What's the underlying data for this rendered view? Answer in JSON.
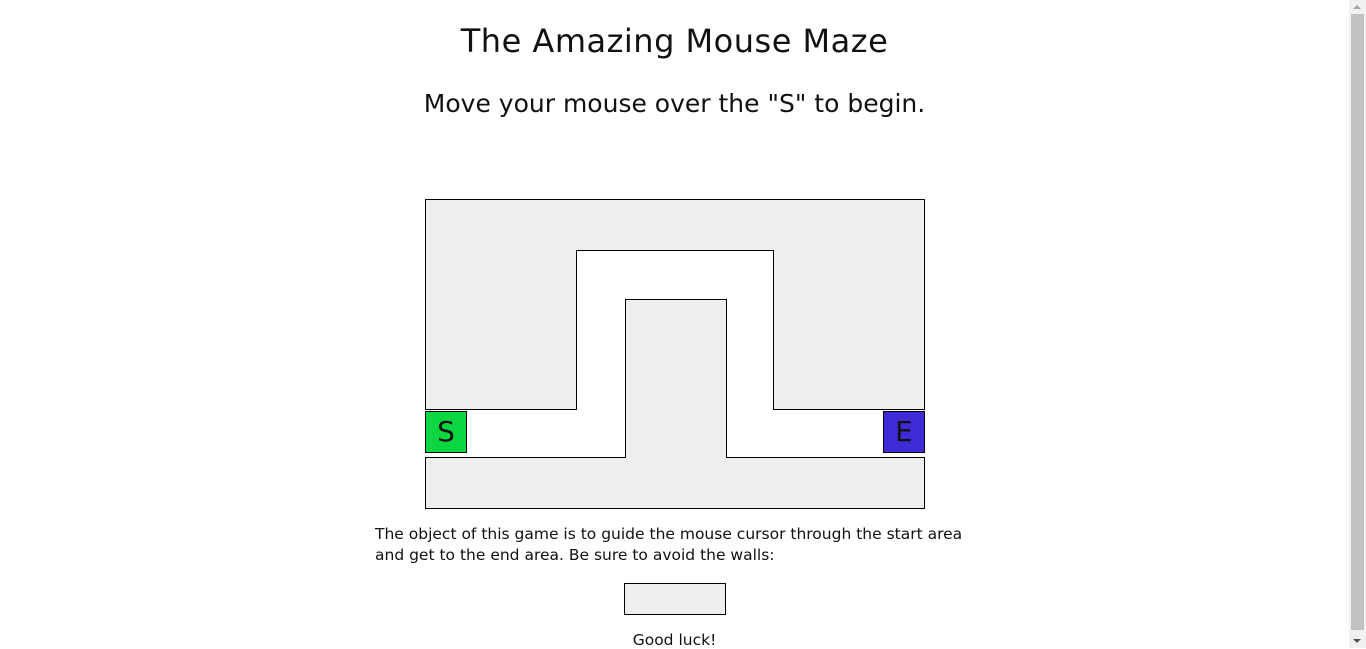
{
  "title": "The Amazing Mouse Maze",
  "status": "Move your mouse over the \"S\" to begin.",
  "maze": {
    "start_label": "S",
    "end_label": "E",
    "start_color": "#0bd642",
    "end_color": "#3f2bd6",
    "wall_color": "#eeeeee"
  },
  "description": "The object of this game is to guide the mouse cursor through the start area and get to the end area. Be sure to avoid the walls:",
  "closing": "Good luck!"
}
